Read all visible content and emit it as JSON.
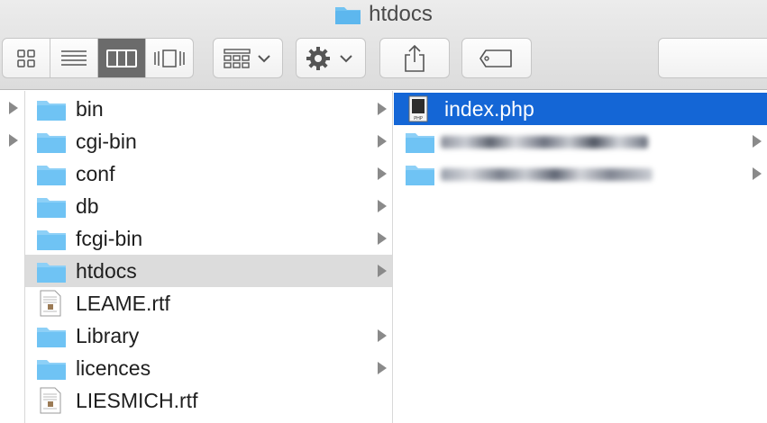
{
  "window": {
    "title": "htdocs"
  },
  "toolbar": {
    "view_buttons": [
      "icon-view",
      "list-view",
      "column-view",
      "cover-flow-view"
    ]
  },
  "column0": {
    "rows": 2
  },
  "column1": {
    "items": [
      {
        "label": "bin",
        "type": "folder",
        "arrow": true
      },
      {
        "label": "cgi-bin",
        "type": "folder",
        "arrow": true
      },
      {
        "label": "conf",
        "type": "folder",
        "arrow": true
      },
      {
        "label": "db",
        "type": "folder",
        "arrow": true
      },
      {
        "label": "fcgi-bin",
        "type": "folder",
        "arrow": true
      },
      {
        "label": "htdocs",
        "type": "folder",
        "arrow": true,
        "selected": true
      },
      {
        "label": "LEAME.rtf",
        "type": "rtf-file",
        "arrow": false
      },
      {
        "label": "Library",
        "type": "folder",
        "arrow": true
      },
      {
        "label": "licences",
        "type": "folder",
        "arrow": true
      },
      {
        "label": "LIESMICH.rtf",
        "type": "rtf-file",
        "arrow": false
      }
    ]
  },
  "column2": {
    "items": [
      {
        "label": "index.php",
        "type": "php-file",
        "selected": true
      },
      {
        "label": "",
        "type": "folder",
        "blurred": true,
        "arrow": true
      },
      {
        "label": "",
        "type": "folder",
        "blurred": true,
        "arrow": true
      }
    ]
  },
  "colors": {
    "selection_blue": "#1466d6",
    "selection_gray": "#dcdcdc",
    "folder_blue": "#6fc3f4"
  }
}
